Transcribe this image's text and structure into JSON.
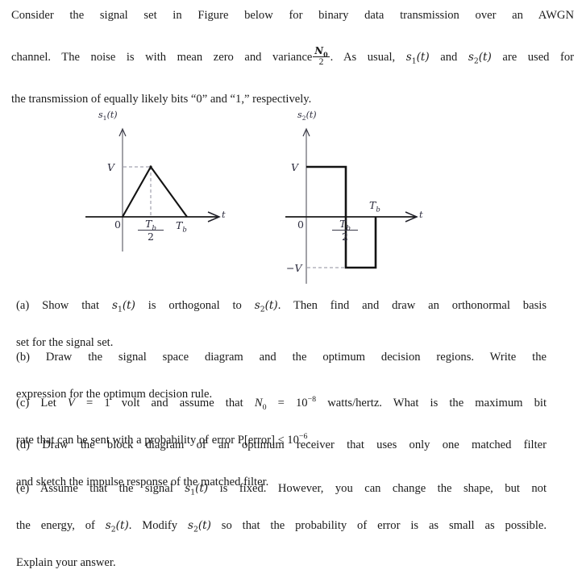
{
  "document": {
    "intro": {
      "line1": "Consider the signal set in Figure below for binary data transmission over an AWGN",
      "line2_a": "channel. The noise is with mean zero and variance",
      "line2_frac_num": "N",
      "line2_frac_num_sub": "0",
      "line2_frac_den": "2",
      "line2_b": ". As usual,",
      "line2_s1": "s",
      "line2_s1_sub": "1",
      "line2_s1_arg": "(t)",
      "line2_and": "and",
      "line2_s2": "s",
      "line2_s2_sub": "2",
      "line2_s2_arg": "(t)",
      "line2_c": "are used for",
      "line3": "the transmission of equally likely bits “0” and “1,” respectively."
    },
    "parts": {
      "a": {
        "marker": "(a)",
        "text_1": "Show that",
        "sig1": "s",
        "sig1_sub": "1",
        "sig1_arg": "(t)",
        "text_2": "is orthogonal to",
        "sig2": "s",
        "sig2_sub": "2",
        "sig2_arg": "(t)",
        "text_3": ". Then find and draw an orthonormal basis",
        "line2": "set for the signal set."
      },
      "b": {
        "marker": "(b)",
        "line1": "Draw the signal space diagram and the optimum decision regions. Write the",
        "line2": "expression for the optimum decision rule."
      },
      "c": {
        "marker": "(c)",
        "text_1": "Let",
        "v_symbol": "V",
        "eq1": "=",
        "text_2": "1 volt and assume that",
        "n0_symbol": "N",
        "n0_sub": "0",
        "eq2": "=",
        "pow_base": "10",
        "pow_exp": "−8",
        "text_3": "watts/hertz. What is the maximum bit",
        "line2_a": "rate that can be sent with a probability of error P[error]",
        "leq": "≤",
        "line2_pow_base": "10",
        "line2_pow_exp": "−6",
        "line2_b": "."
      },
      "d": {
        "marker": "(d)",
        "line1": "Draw the block diagram of an optimum receiver that uses only one matched filter",
        "line2": "and sketch the impulse response of the matched filter."
      },
      "e": {
        "marker": "(e)",
        "text_1": "Assume that the signal",
        "sig1": "s",
        "sig1_sub": "1",
        "sig1_arg": "(t)",
        "text_2": "is fixed. However, you can change the shape, but not",
        "line2_a": "the energy, of",
        "sig2": "s",
        "sig2_sub": "2",
        "sig2_arg": "(t)",
        "line2_b": ". Modify",
        "sig3": "s",
        "sig3_sub": "2",
        "sig3_arg": "(t)",
        "line2_c": "so that the probability of error is as small as possible.",
        "line3": "Explain your answer."
      }
    }
  },
  "chart_data": [
    {
      "type": "line",
      "name": "signal-s1",
      "title": "s₁(t)",
      "title_base": "s",
      "title_sub": "1",
      "title_arg": "(t)",
      "xlabel": "t",
      "ylabel": "",
      "origin_label": "0",
      "x": [
        0,
        0.5,
        1
      ],
      "y": [
        0,
        1,
        0
      ],
      "xtick_labels": [
        "0",
        "T_b/2",
        "T_b"
      ],
      "xtick_values": [
        0,
        0.5,
        1
      ],
      "ytick_labels": [
        "V"
      ],
      "ytick_values": [
        1
      ],
      "ylim": [
        0,
        1.35
      ],
      "xlim": [
        -0.12,
        1.45
      ],
      "grid": false,
      "legend": "none",
      "annotations": [
        "dashed guide from V to apex at T_b/2"
      ],
      "tick_tb_half_num": "T",
      "tick_tb_half_num_sub": "b",
      "tick_tb_half_den": "2",
      "tick_tb": "T",
      "tick_tb_sub": "b",
      "ylabel_v": "V"
    },
    {
      "type": "line",
      "name": "signal-s2",
      "title": "s₂(t)",
      "title_base": "s",
      "title_sub": "2",
      "title_arg": "(t)",
      "xlabel": "t",
      "ylabel": "",
      "origin_label": "0",
      "x": [
        0,
        0.5,
        0.5,
        1,
        1
      ],
      "y": [
        1,
        1,
        -1,
        -1,
        0
      ],
      "xtick_labels": [
        "0",
        "T_b/2",
        "T_b"
      ],
      "xtick_values": [
        0,
        0.5,
        1
      ],
      "ytick_labels": [
        "V",
        "−V"
      ],
      "ytick_values": [
        1,
        -1
      ],
      "ylim": [
        -1.05,
        1.35
      ],
      "xlim": [
        -0.12,
        1.45
      ],
      "grid": false,
      "legend": "none",
      "annotations": [
        "dashed guide at −V level"
      ],
      "tick_tb_half_num": "T",
      "tick_tb_half_num_sub": "b",
      "tick_tb_half_den": "2",
      "tick_tb": "T",
      "tick_tb_sub": "b",
      "ylabel_v": "V",
      "ylabel_negv": "−V"
    }
  ],
  "colors": {
    "text": "#1c1c1c",
    "curve": "#111111",
    "axis": "#4a4a55",
    "label": "#2b2b3d",
    "dashed": "#8a8a99"
  }
}
